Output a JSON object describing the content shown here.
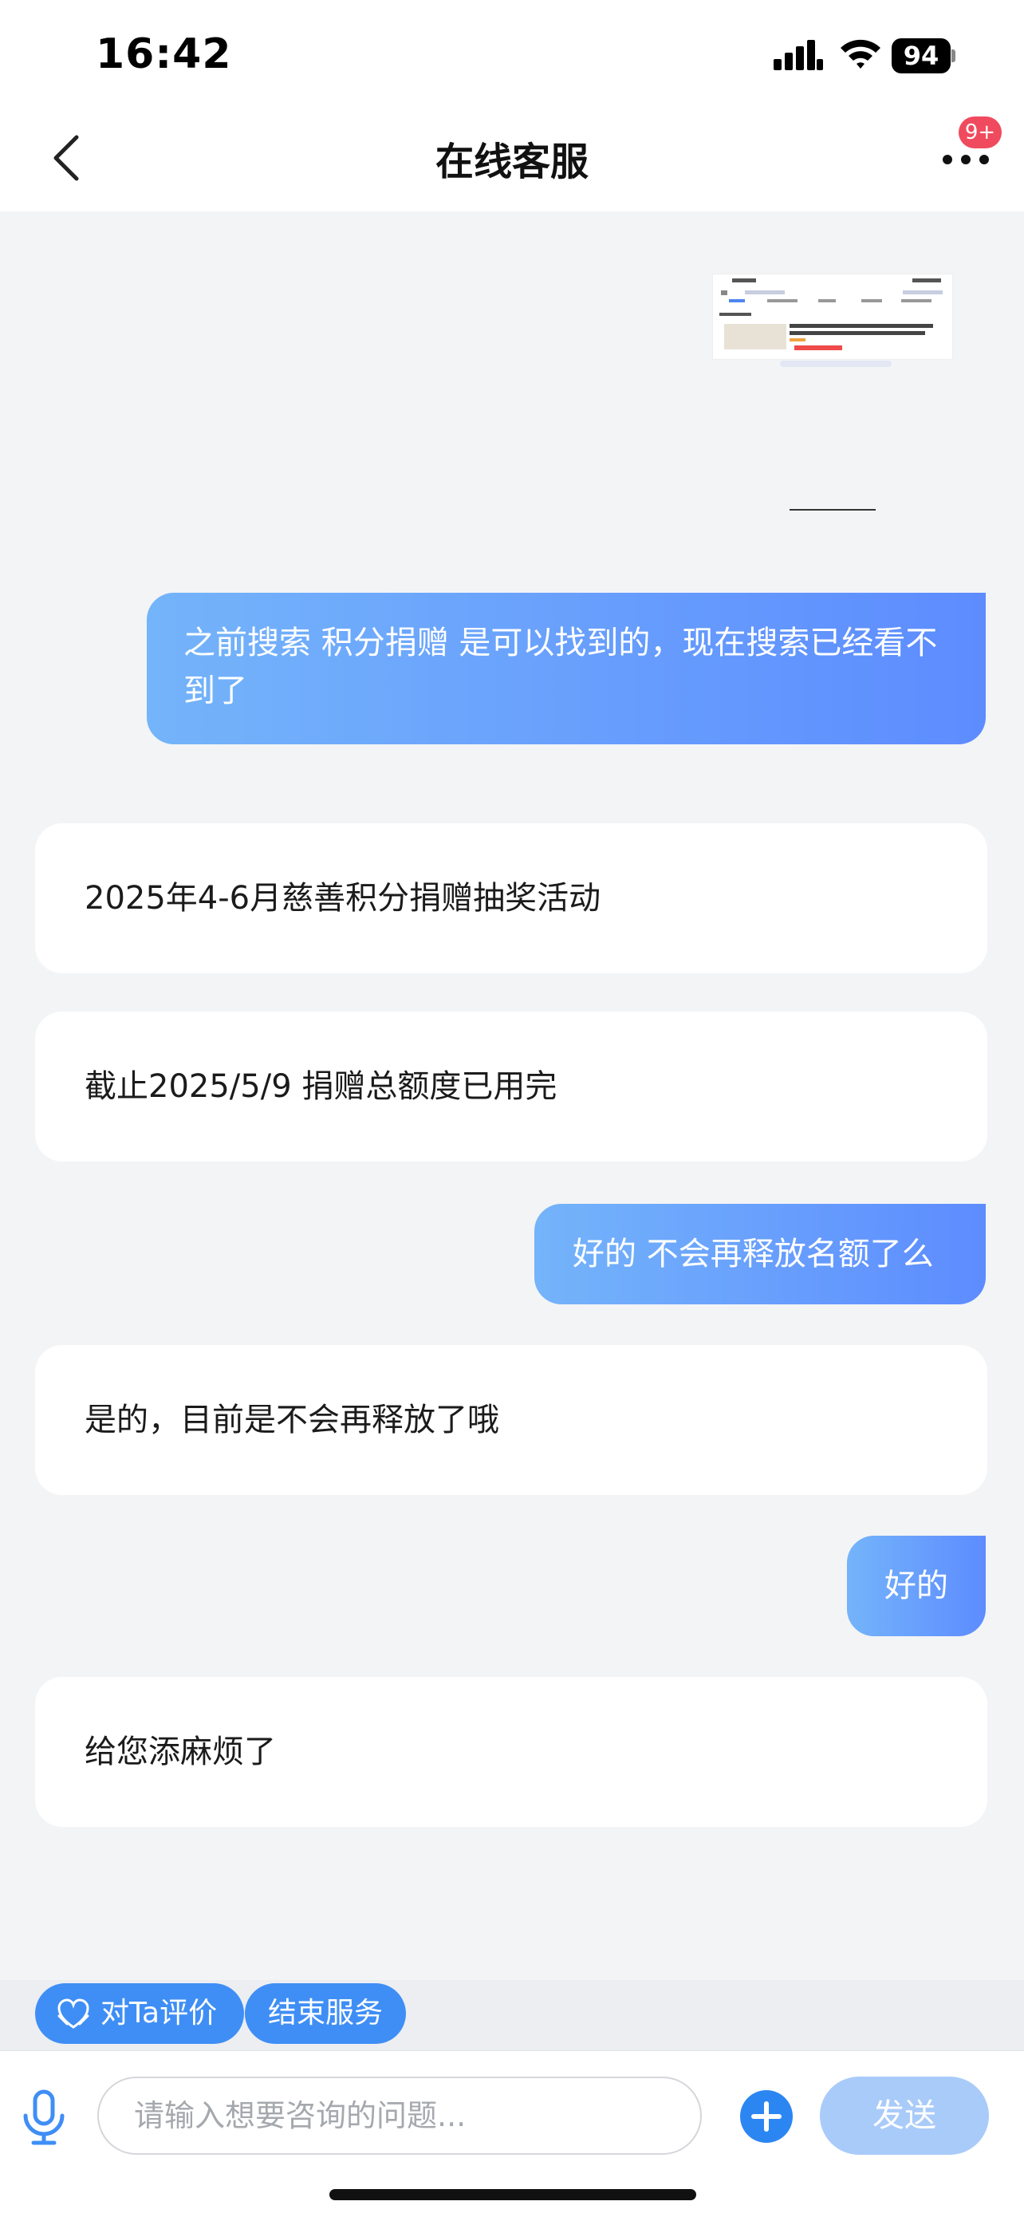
{
  "status_bar": {
    "time": "16:42",
    "battery": "94"
  },
  "header": {
    "title": "在线客服",
    "badge": "9+"
  },
  "messages": [
    {
      "from": "user",
      "text": "之前搜索 积分捐赠 是可以找到的，现在搜索已经看不到了"
    },
    {
      "from": "agent",
      "text": "2025年4-6月慈善积分捐赠抽奖活动"
    },
    {
      "from": "agent",
      "text": "截止2025/5/9 捐赠总额度已用完"
    },
    {
      "from": "user",
      "text": "好的 不会再释放名额了么"
    },
    {
      "from": "agent",
      "text": "是的，目前是不会再释放了哦"
    },
    {
      "from": "user",
      "text": "好的"
    },
    {
      "from": "agent",
      "text": "给您添麻烦了"
    }
  ],
  "quick_actions": {
    "rate": "对Ta评价",
    "end": "结束服务"
  },
  "input": {
    "placeholder": "请输入想要咨询的问题...",
    "send": "发送"
  },
  "colors": {
    "accent": "#3f8ef5",
    "user_bubble_start": "#74b4fa",
    "user_bubble_end": "#5d8cff",
    "badge": "#f04a5e",
    "send_disabled": "#a9cbf9",
    "background": "#f3f4f6"
  }
}
